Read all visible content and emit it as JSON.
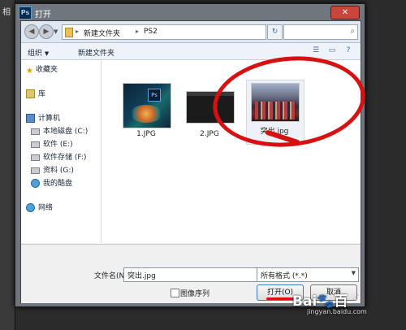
{
  "background": {
    "left_glyph": "相"
  },
  "dialog": {
    "title": "打开",
    "app_icon": "Ps",
    "close_symbol": "✕",
    "address": {
      "crumbs": [
        "新建文件夹",
        "PS2"
      ],
      "separators": [
        "▸",
        "▸"
      ]
    },
    "toolbar": {
      "organize": "组织",
      "new_folder": "新建文件夹"
    },
    "sidebar": {
      "favorites": "收藏夹",
      "libraries": "库",
      "computer": "计算机",
      "drives": [
        "本地磁盘 (C:)",
        "软件 (E:)",
        "软件存储 (F:)",
        "资料 (G:)",
        "我的酷盘"
      ],
      "network": "网络"
    },
    "files": [
      {
        "name": "1.JPG",
        "kind": "photoshop-splash"
      },
      {
        "name": "2.JPG",
        "kind": "dark-screenshot"
      },
      {
        "name": "突出.jpg",
        "kind": "photo"
      }
    ],
    "bottom": {
      "filename_label": "文件名(N):",
      "filename_value": "突出.jpg",
      "filetype_value": "所有格式 (*.*)",
      "image_sequence": "图像序列",
      "open_button": "打开(O)",
      "cancel_button": "取消"
    }
  },
  "annotation_color": "#d81010",
  "watermark": {
    "logo": "Bai🐾百",
    "site": "jingyan.baidu.com"
  }
}
